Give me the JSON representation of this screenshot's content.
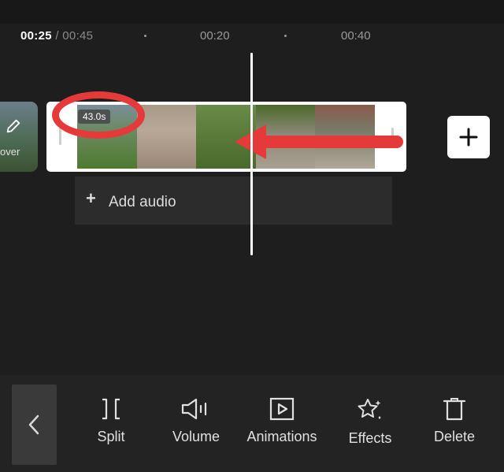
{
  "timeline": {
    "current_time": "00:25",
    "total_time": "/ 00:45",
    "ticks": [
      "00:20",
      "00:40"
    ]
  },
  "cover": {
    "label": "over"
  },
  "clip": {
    "duration": "43.0s"
  },
  "add_audio": {
    "label": "Add audio"
  },
  "toolbar": {
    "items": [
      {
        "label": "Split",
        "icon": "split-icon"
      },
      {
        "label": "Volume",
        "icon": "volume-icon"
      },
      {
        "label": "Animations",
        "icon": "animations-icon"
      },
      {
        "label": "Effects",
        "icon": "effects-icon"
      },
      {
        "label": "Delete",
        "icon": "delete-icon"
      }
    ]
  },
  "colors": {
    "annotation_red": "#e63a3a",
    "background": "#1e1e1e",
    "toolbar_bg": "#232323"
  }
}
